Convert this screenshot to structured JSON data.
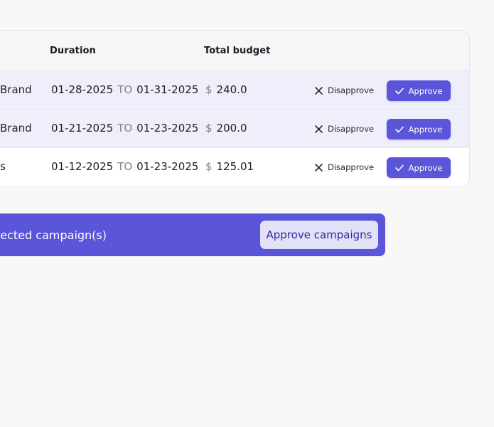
{
  "table": {
    "headers": {
      "duration": "Duration",
      "total_budget": "Total budget"
    },
    "rows": [
      {
        "campaign": "Brand",
        "start": "01-28-2025",
        "to": "TO",
        "end": "01-31-2025",
        "currency": "$",
        "budget": "240.0",
        "disapprove_label": "Disapprove",
        "approve_label": "Approve",
        "selected": true
      },
      {
        "campaign": "Brand",
        "start": "01-21-2025",
        "to": "TO",
        "end": "01-23-2025",
        "currency": "$",
        "budget": "200.0",
        "disapprove_label": "Disapprove",
        "approve_label": "Approve",
        "selected": true
      },
      {
        "campaign": "s",
        "start": "01-12-2025",
        "to": "TO",
        "end": "01-23-2025",
        "currency": "$",
        "budget": "125.01",
        "disapprove_label": "Disapprove",
        "approve_label": "Approve",
        "selected": false
      }
    ]
  },
  "bulk_bar": {
    "text": "elected campaign(s)",
    "approve_button": "Approve campaigns"
  },
  "colors": {
    "accent": "#5b55d9",
    "selected_row": "#efeefb",
    "bulk_button_bg": "#e3e1f7",
    "page_bg": "#f9f8f9"
  },
  "icons": {
    "disapprove": "close-icon",
    "approve": "check-icon"
  }
}
